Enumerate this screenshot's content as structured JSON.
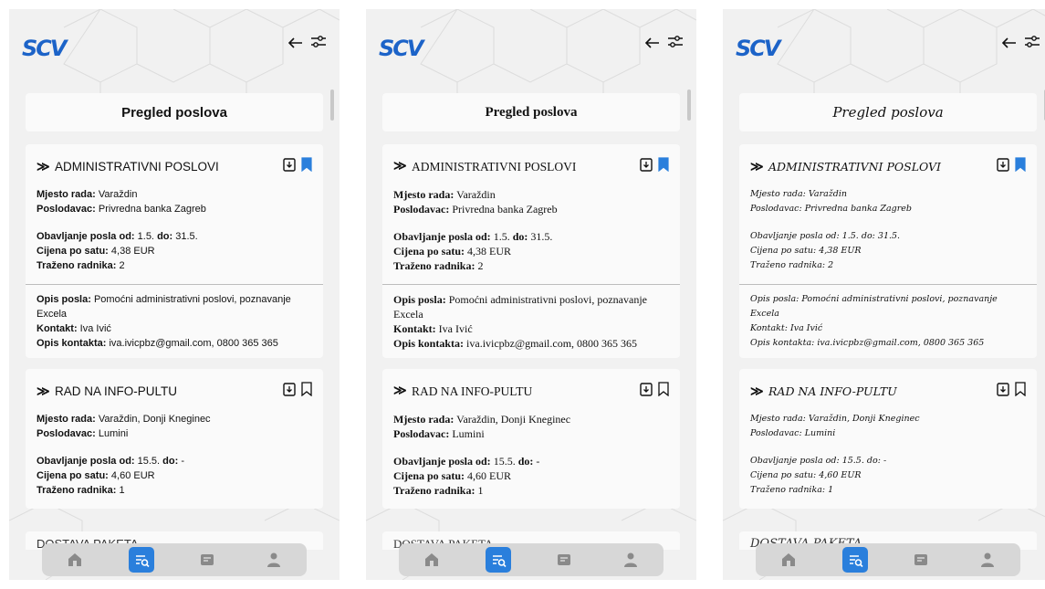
{
  "app": {
    "logo": "SCV",
    "title": "Pregled poslova"
  },
  "labels": {
    "mjesto": "Mjesto rada:",
    "poslodavac": "Poslodavac:",
    "obavljanje": "Obavljanje posla od:",
    "do": "do:",
    "cijena": "Cijena po satu:",
    "trazeno": "Traženo radnika:",
    "opis": "Opis posla:",
    "kontakt": "Kontakt:",
    "opis_kontakta": "Opis kontakta:"
  },
  "jobs": [
    {
      "title": "ADMINISTRATIVNI POSLOVI",
      "mjesto": "Varaždin",
      "poslodavac": "Privredna banka Zagreb",
      "od": "1.5.",
      "do": "31.5.",
      "cijena": "4,38 EUR",
      "trazeno": "2",
      "opis": "Pomoćni administrativni poslovi, poznavanje Excela",
      "kontakt": "Iva Ivić",
      "opis_kontakta": "iva.ivicpbz@gmail.com, 0800 365 365",
      "bookmarked": true
    },
    {
      "title": "RAD NA INFO-PULTU",
      "mjesto": "Varaždin, Donji Kneginec",
      "poslodavac": "Lumini",
      "od": "15.5.",
      "do": "-",
      "cijena": "4,60 EUR",
      "trazeno": "1",
      "bookmarked": false
    },
    {
      "title": "DOSTAVA PAKETA"
    }
  ],
  "nav": [
    "home-icon",
    "job-search-icon",
    "job-list-icon",
    "profile-icon"
  ],
  "colors": {
    "accent": "#2a7fdc",
    "logo": "#1c63c8"
  }
}
